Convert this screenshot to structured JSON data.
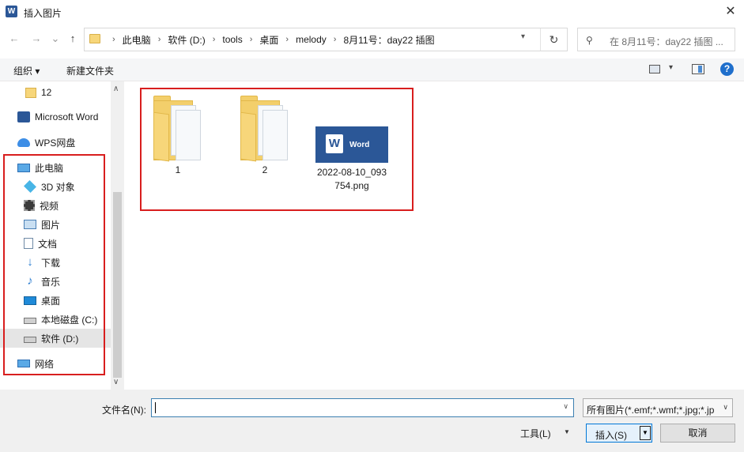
{
  "window": {
    "title": "插入图片",
    "app_icon_letter": "W",
    "close_glyph": "✕"
  },
  "nav": {
    "back": "←",
    "forward": "→",
    "recent": "⌄",
    "up": "↑",
    "breadcrumbs": [
      "此电脑",
      "软件 (D:)",
      "tools",
      "桌面",
      "melody",
      "8月11号：day22 插图"
    ],
    "refresh": "↻",
    "search_placeholder": "在 8月11号：day22 插图 ..."
  },
  "toolbar": {
    "organize": "组织",
    "new_folder": "新建文件夹",
    "help": "?"
  },
  "sidebar": {
    "items": [
      {
        "label": "12",
        "icon": "folder-icon"
      },
      {
        "label": "Microsoft Word",
        "icon": "word-icon"
      },
      {
        "label": "WPS网盘",
        "icon": "cloud-icon"
      },
      {
        "label": "此电脑",
        "icon": "computer-icon"
      },
      {
        "label": "3D 对象",
        "icon": "cube-icon"
      },
      {
        "label": "视频",
        "icon": "video-icon"
      },
      {
        "label": "图片",
        "icon": "picture-icon"
      },
      {
        "label": "文档",
        "icon": "document-icon"
      },
      {
        "label": "下载",
        "icon": "download-icon"
      },
      {
        "label": "音乐",
        "icon": "music-icon"
      },
      {
        "label": "桌面",
        "icon": "desktop-icon"
      },
      {
        "label": "本地磁盘 (C:)",
        "icon": "drive-icon"
      },
      {
        "label": "软件 (D:)",
        "icon": "drive-icon",
        "selected": true
      },
      {
        "label": "网络",
        "icon": "network-icon"
      }
    ]
  },
  "files": [
    {
      "name": "1",
      "type": "folder"
    },
    {
      "name": "2",
      "type": "folder"
    },
    {
      "name_line1": "2022-08-10_093",
      "name_line2": "754.png",
      "type": "image",
      "thumb_logo": "W",
      "thumb_text": "Word"
    }
  ],
  "footer": {
    "filename_label": "文件名(N):",
    "filename_value": "",
    "filter_value": "所有图片(*.emf;*.wmf;*.jpg;*.jp",
    "tools_label": "工具(L)",
    "insert_label": "插入(S)",
    "cancel_label": "取消"
  },
  "colors": {
    "highlight_box": "#d81e1e",
    "word_blue": "#2b5797",
    "accent": "#0078d7"
  }
}
